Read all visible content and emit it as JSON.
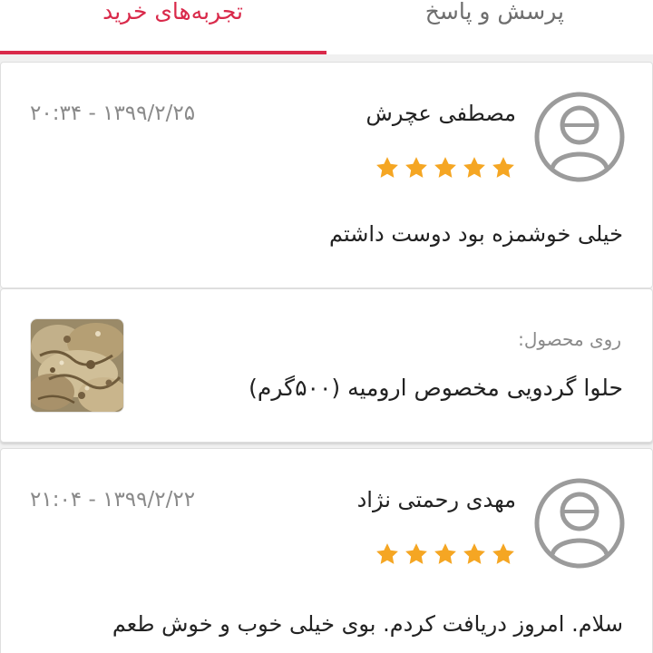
{
  "tabs": [
    {
      "label": "تجربه‌های خرید",
      "active": true
    },
    {
      "label": "پرسش و پاسخ",
      "active": false
    }
  ],
  "accent_color": "#d9294a",
  "star_color": "#f5a623",
  "reviews": [
    {
      "name": "مصطفی عچرش",
      "date": "۱۳۹۹/۲/۲۵ - ۲۰:۳۴",
      "rating": 5,
      "text": "خیلی خوشمزه بود دوست داشتم",
      "avatar_icon": "user-avatar-icon"
    },
    {
      "name": "مهدی رحمتی نژاد",
      "date": "۱۳۹۹/۲/۲۲ - ۲۱:۰۴",
      "rating": 5,
      "text": "سلام. امروز دریافت کردم. بوی خیلی خوب و خوش طعم",
      "avatar_icon": "user-avatar-icon"
    }
  ],
  "product": {
    "label": "روی محصول:",
    "name": "حلوا گردویی مخصوص ارومیه (۵۰۰گرم)"
  }
}
